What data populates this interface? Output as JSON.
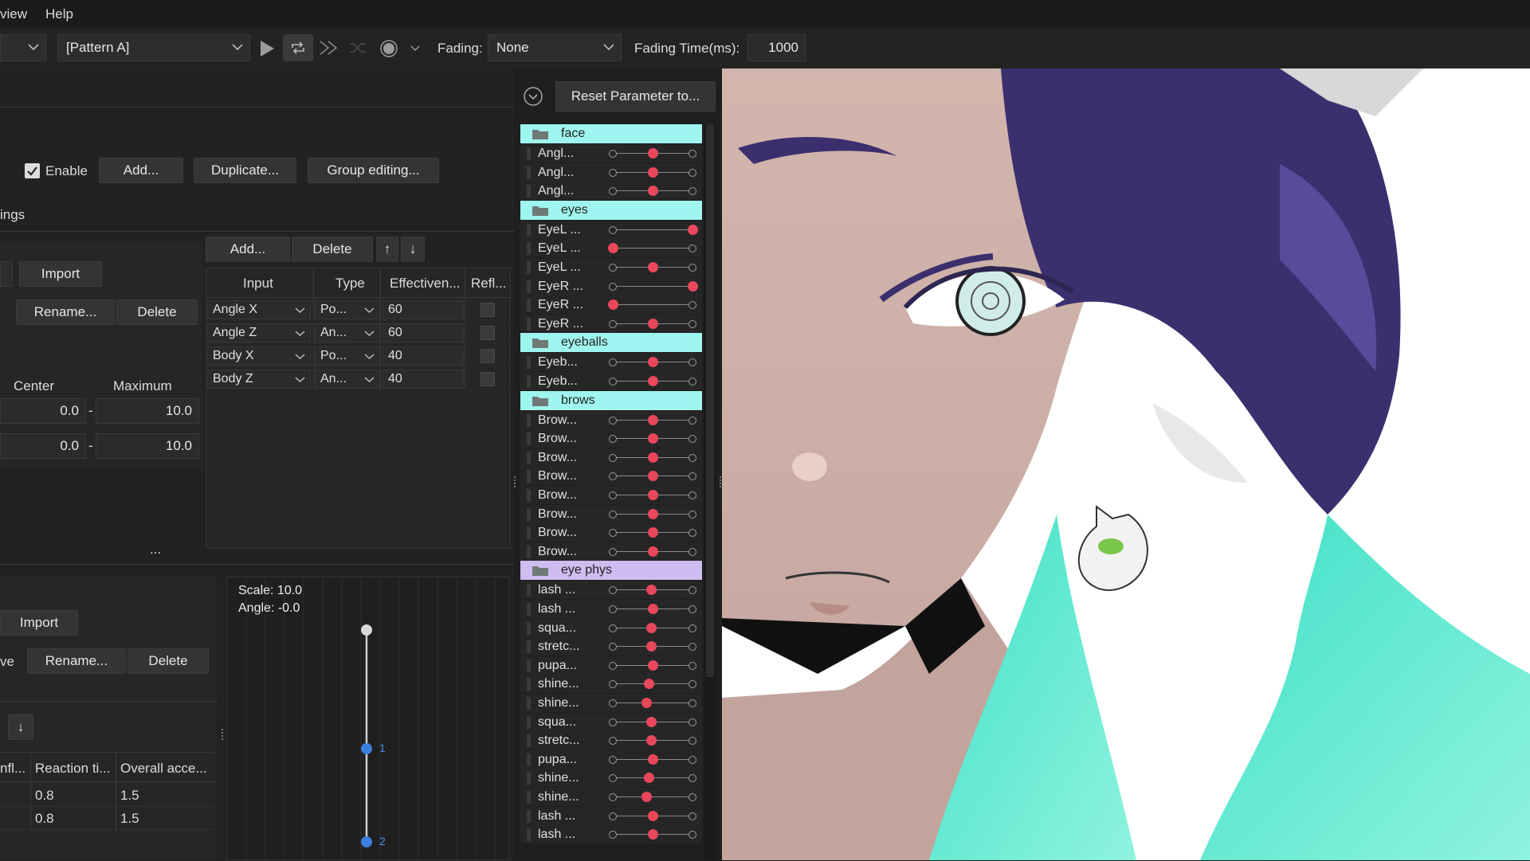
{
  "menu": {
    "view": "view",
    "help": "Help"
  },
  "toolbar": {
    "pattern": "[Pattern A]",
    "fading_label": "Fading:",
    "fading_value": "None",
    "fading_time_label": "Fading Time(ms):",
    "fading_time_value": "1000"
  },
  "settings": {
    "enable": "Enable",
    "add": "Add...",
    "duplicate": "Duplicate...",
    "group_editing": "Group editing...",
    "section": "ings"
  },
  "left_a": {
    "import": "Import",
    "rename": "Rename...",
    "delete": "Delete",
    "center": "Center",
    "maximum": "Maximum",
    "rows": [
      {
        "center": "0.0",
        "sep": "-",
        "max": "10.0"
      },
      {
        "center": "0.0",
        "sep": "-",
        "max": "10.0"
      }
    ],
    "ellipsis": "..."
  },
  "inputs": {
    "add": "Add...",
    "delete": "Delete",
    "up": "↑",
    "down": "↓",
    "headers": {
      "input": "Input",
      "type": "Type",
      "effect": "Effectiven...",
      "refl": "Refl..."
    },
    "rows": [
      {
        "input": "Angle X",
        "type": "Po...",
        "eff": "60"
      },
      {
        "input": "Angle Z",
        "type": "An...",
        "eff": "60"
      },
      {
        "input": "Body X",
        "type": "Po...",
        "eff": "40"
      },
      {
        "input": "Body Z",
        "type": "An...",
        "eff": "40"
      }
    ]
  },
  "left_b": {
    "import": "Import",
    "ve": "ve",
    "rename": "Rename...",
    "delete": "Delete",
    "down": "↓",
    "headers": {
      "infl": "nfl...",
      "reaction": "Reaction ti...",
      "overall": "Overall acce..."
    },
    "rows": [
      {
        "reaction": "0.8",
        "overall": "1.5"
      },
      {
        "reaction": "0.8",
        "overall": "1.5"
      }
    ]
  },
  "pendulum": {
    "scale": "Scale: 10.0",
    "angle": "Angle: -0.0",
    "node1": "1",
    "node2": "2"
  },
  "params": {
    "reset": "Reset Parameter to...",
    "groups": [
      {
        "name": "face",
        "color": "#9ff5ef",
        "items": [
          {
            "label": "Angl...",
            "v": 0.5
          },
          {
            "label": "Angl...",
            "v": 0.5
          },
          {
            "label": "Angl...",
            "v": 0.5
          }
        ]
      },
      {
        "name": "eyes",
        "color": "#9ff5ef",
        "items": [
          {
            "label": "EyeL ...",
            "v": 1.0
          },
          {
            "label": "EyeL ...",
            "v": 0.0
          },
          {
            "label": "EyeL ...",
            "v": 0.5
          },
          {
            "label": "EyeR ...",
            "v": 1.0
          },
          {
            "label": "EyeR ...",
            "v": 0.0
          },
          {
            "label": "EyeR ...",
            "v": 0.5
          }
        ]
      },
      {
        "name": "eyeballs",
        "color": "#9ff5ef",
        "items": [
          {
            "label": "Eyeb...",
            "v": 0.5
          },
          {
            "label": "Eyeb...",
            "v": 0.5
          }
        ]
      },
      {
        "name": "brows",
        "color": "#9ff5ef",
        "items": [
          {
            "label": "Brow...",
            "v": 0.5
          },
          {
            "label": "Brow...",
            "v": 0.5
          },
          {
            "label": "Brow...",
            "v": 0.5
          },
          {
            "label": "Brow...",
            "v": 0.5
          },
          {
            "label": "Brow...",
            "v": 0.5
          },
          {
            "label": "Brow...",
            "v": 0.5
          },
          {
            "label": "Brow...",
            "v": 0.5
          },
          {
            "label": "Brow...",
            "v": 0.5
          }
        ]
      },
      {
        "name": "eye phys",
        "color": "#cfbcf0",
        "items": [
          {
            "label": "lash ...",
            "v": 0.48
          },
          {
            "label": "lash ...",
            "v": 0.5
          },
          {
            "label": "squa...",
            "v": 0.48
          },
          {
            "label": "stretc...",
            "v": 0.48
          },
          {
            "label": "pupa...",
            "v": 0.5
          },
          {
            "label": "shine...",
            "v": 0.45
          },
          {
            "label": "shine...",
            "v": 0.42
          },
          {
            "label": "squa...",
            "v": 0.48
          },
          {
            "label": "stretc...",
            "v": 0.48
          },
          {
            "label": "pupa...",
            "v": 0.5
          },
          {
            "label": "shine...",
            "v": 0.45
          },
          {
            "label": "shine...",
            "v": 0.42
          },
          {
            "label": "lash ...",
            "v": 0.5
          },
          {
            "label": "lash ...",
            "v": 0.5
          }
        ]
      }
    ]
  }
}
